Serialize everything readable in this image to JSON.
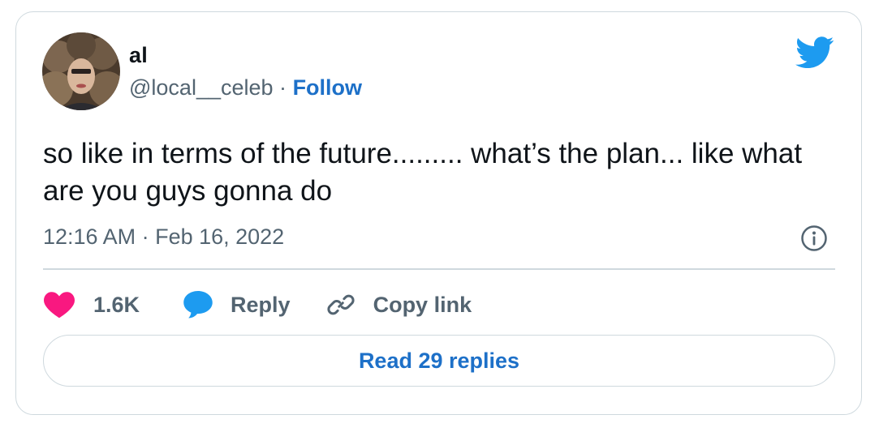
{
  "author": {
    "name": "al",
    "handle": "@local__celeb",
    "separator": "·",
    "follow_label": "Follow",
    "avatar_icon": "profile-photo"
  },
  "tweet": {
    "text": "so like in terms of the future......... what’s the plan... like what are you guys gonna do",
    "timestamp": "12:16 AM · Feb 16, 2022"
  },
  "actions": {
    "like_count": "1.6K",
    "reply_label": "Reply",
    "copy_link_label": "Copy link",
    "read_replies_label": "Read 29 replies"
  },
  "icons": {
    "brand": "twitter-bird-icon",
    "info": "info-icon",
    "like": "heart-icon",
    "reply": "speech-bubble-icon",
    "copy": "link-icon"
  },
  "colors": {
    "brand_blue": "#1d9bf0",
    "link_blue": "#1d70c8",
    "like_pink": "#f91880",
    "muted": "#536471",
    "border": "#cfd9de"
  }
}
